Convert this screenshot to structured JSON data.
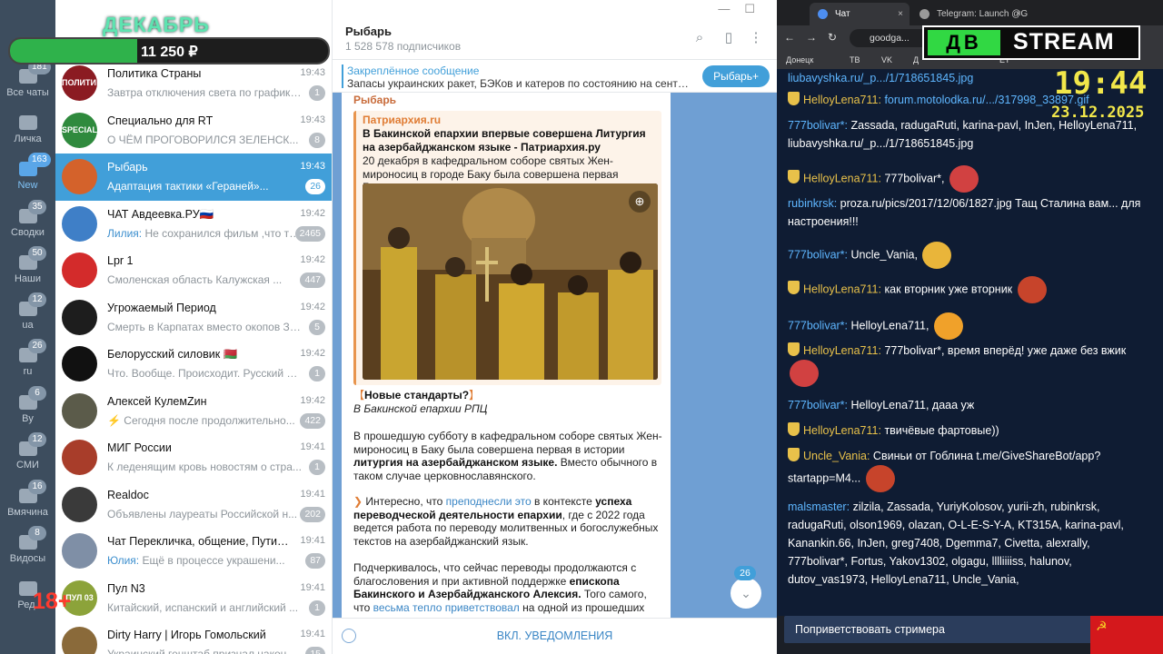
{
  "overlay": {
    "month": "ДЕКАБРЬ",
    "amount": "11 250 ₽",
    "progress_fraction": 0.4,
    "age_rating": "18+",
    "logo_db": "ДВ",
    "logo_stream": "STREAM",
    "clock_time": "19:44",
    "clock_date": "23.12.2025"
  },
  "folders": [
    {
      "label": "Все чаты",
      "badge": "181"
    },
    {
      "label": "Личка",
      "badge": ""
    },
    {
      "label": "New",
      "badge": "163"
    },
    {
      "label": "Сводки",
      "badge": "35"
    },
    {
      "label": "Наши",
      "badge": "50"
    },
    {
      "label": "ua",
      "badge": "12"
    },
    {
      "label": "ru",
      "badge": "26"
    },
    {
      "label": "By",
      "badge": "6"
    },
    {
      "label": "СМИ",
      "badge": "12"
    },
    {
      "label": "Вмячина",
      "badge": "16"
    },
    {
      "label": "Видосы",
      "badge": "8"
    },
    {
      "label": "Ред.",
      "badge": ""
    }
  ],
  "chats": [
    {
      "name": "Политика Страны",
      "time": "19:43",
      "preview": "Завтра отключения света по графика...",
      "sender": "",
      "badge": "1",
      "avatar_color": "#8b1b22",
      "avatar_text": "ПОЛИТИКА"
    },
    {
      "name": "Специально для RT",
      "time": "19:43",
      "preview": "О ЧЁМ ПРОГОВОРИЛСЯ ЗЕЛЕНСК...",
      "sender": "",
      "badge": "8",
      "avatar_color": "#2f8a3d",
      "avatar_text": "SPECIAL"
    },
    {
      "name": "Рыбарь",
      "time": "19:43",
      "preview": "Адаптация тактики «Гераней»...",
      "sender": "",
      "badge": "26",
      "avatar_color": "#d4622b",
      "avatar_text": ""
    },
    {
      "name": "ЧАТ Авдеевка.РУ🇷🇺",
      "time": "19:42",
      "preview": "Не сохранился фильм ,что ты ...",
      "sender": "Лилия: ",
      "badge": "2465",
      "avatar_color": "#3f7fc7",
      "avatar_text": ""
    },
    {
      "name": "Lpr 1",
      "time": "19:42",
      "preview": "Смоленская область  Калужская ...",
      "sender": "",
      "badge": "447",
      "avatar_color": "#d32b2b",
      "avatar_text": ""
    },
    {
      "name": "Угрожаемый Период",
      "time": "19:42",
      "preview": "Смерть в Карпатах вместо окопов Зе...",
      "sender": "",
      "badge": "5",
      "avatar_color": "#1d1d1d",
      "avatar_text": ""
    },
    {
      "name": "Белорусский силовик 🇧🇾",
      "time": "19:42",
      "preview": "Что. Вообще. Происходит.  Русский м...",
      "sender": "",
      "badge": "1",
      "avatar_color": "#111111",
      "avatar_text": ""
    },
    {
      "name": "Алексей КулемZин",
      "time": "19:42",
      "preview": "⚡ Сегодня после продолжительно...",
      "sender": "",
      "badge": "422",
      "avatar_color": "#5b5b4a",
      "avatar_text": ""
    },
    {
      "name": "МИГ России",
      "time": "19:41",
      "preview": "К леденящим кровь новостям о стра...",
      "sender": "",
      "badge": "1",
      "avatar_color": "#a83d2a",
      "avatar_text": ""
    },
    {
      "name": "Realdoc",
      "time": "19:41",
      "preview": "Объявлены лауреаты Российской н...",
      "sender": "",
      "badge": "202",
      "avatar_color": "#3a3a3a",
      "avatar_text": ""
    },
    {
      "name": "Чат Перекличка, общение, Путил...",
      "time": "19:41",
      "preview": "Ещё в процессе украшени...",
      "sender": "Юлия: ",
      "badge": "87",
      "avatar_color": "#7f8fa6",
      "avatar_text": ""
    },
    {
      "name": "Пул N3",
      "time": "19:41",
      "preview": "Китайский, испанский и английский ...",
      "sender": "",
      "badge": "1",
      "avatar_color": "#8ca33a",
      "avatar_text": "ПУЛ 03"
    },
    {
      "name": "Dirty Harry | Игорь Гомольский",
      "time": "19:41",
      "preview": "Украинский генштаб признал наконец у...",
      "sender": "",
      "badge": "15",
      "avatar_color": "#8a6a3a",
      "avatar_text": ""
    }
  ],
  "channel": {
    "title": "Рыбарь",
    "subscribers": "1 528 578 подписчиков",
    "pinned_title": "Закреплённое сообщение",
    "pinned_text": "Запасы украинских ракет, БЭКов и катеров по состоянию на сентяб...",
    "pinned_button": "Рыбарь+",
    "notify_button": "ВКЛ. УВЕДОМЛЕНИЯ",
    "scroll_badge": "26"
  },
  "message": {
    "author": "Рыбарь",
    "quote_source": "Патриархия.ru",
    "quote_title": "В Бакинской епархии впервые совершена Литургия на азербайджанском языке - Патриархия.ру",
    "quote_desc": "20 декабря в кафедральном соборе святых Жен-мироносиц в городе Баку была совершена первая Божественная литурги...",
    "heading": "Новые стандарты?",
    "heading_sub": "В Бакинской епархии РПЦ",
    "p1_a": "В прошедшую субботу в кафедральном соборе святых Жен-мироносиц в Баку была совершена первая в истории ",
    "p1_b": "литургия на азербайджанском языке.",
    "p1_c": " Вместо обычного в таком случае церковнославянского.",
    "p2_a": "Интересно, что ",
    "p2_link": "преподнесли это",
    "p2_b": " в контексте ",
    "p2_bold": "успеха переводческой деятельности епархии",
    "p2_c": ", где с 2022 года ведется работа по переводу молитвенных и богослужебных текстов на азербайджанский язык.",
    "p3_a": "Подчеркивалось, что сейчас переводы продолжаются с благословения и при активной поддержке ",
    "p3_bold": "епископа Бакинского и Азербайджанского Алексия.",
    "p3_b": " Того самого, что ",
    "p3_link": "весьма тепло приветствовал",
    "p3_c": " на одной из прошедших"
  },
  "browser": {
    "tab1": "Чат",
    "tab2": "Telegram: Launch @G",
    "url": "goodga...",
    "bookmarks": [
      "Донецк",
      "ТВ",
      "VK",
      "Д",
      "ЕТ"
    ]
  },
  "stream_chat": [
    {
      "user": "",
      "text": "liubavyshka.ru/_p.../1/718651845.jpg",
      "gold": false,
      "link": true
    },
    {
      "user": "HelloyLena711:",
      "text": "forum.motolodka.ru/.../317998_33897.gif",
      "gold": true,
      "link": true
    },
    {
      "user": "777bolivar*:",
      "text": "Zassada, radugaRuti, karina-pavl, InJen, HelloyLena711, liubavyshka.ru/_p.../1/718651845.jpg",
      "gold": false,
      "link": false
    },
    {
      "user": "HelloyLena711:",
      "text": "777bolivar*,",
      "gold": true,
      "link": false
    },
    {
      "user": "rubinkrsk:",
      "text": "proza.ru/pics/2017/12/06/1827.jpg Тащ Сталина вам... для настроения!!!",
      "gold": false,
      "link": false
    },
    {
      "user": "777bolivar*:",
      "text": "Uncle_Vania,",
      "gold": false,
      "link": false
    },
    {
      "user": "HelloyLena711:",
      "text": "как вторник  уже вторник",
      "gold": true,
      "link": false
    },
    {
      "user": "777bolivar*:",
      "text": "HelloyLena711,",
      "gold": false,
      "link": false
    },
    {
      "user": "HelloyLena711:",
      "text": "777bolivar*, время вперёд! уже даже без вжик",
      "gold": true,
      "link": false
    },
    {
      "user": "777bolivar*:",
      "text": "HelloyLena711, дааа уж",
      "gold": false,
      "link": false
    },
    {
      "user": "HelloyLena711:",
      "text": "твичёвые фартовые))",
      "gold": true,
      "link": false
    },
    {
      "user": "Uncle_Vania:",
      "text": "Свиньи от Гоблина t.me/GiveShareBot/app?startapp=M4...",
      "gold": true,
      "link": false
    },
    {
      "user": "malsmaster:",
      "text": "zilzila, Zassada, YuriyKolosov, yurii-zh, rubinkrsk, radugaRuti, olson1969, olazan, O-L-E-S-Y-A, KT315A, karina-pavl, Kanankin.66, InJen, greg7408, Dgemma7, Civetta, alexrally, 777bolivar*, Fortus, Yakov1302, olgagu, lllliiiiss, halunov, dutov_vas1973, HelloyLena711, Uncle_Vania,",
      "gold": false,
      "link": false
    }
  ],
  "chat_input_placeholder": "Поприветствовать стримера",
  "colors": {
    "telegram_blue": "#419fd9",
    "overlay_green": "#2fb24b",
    "clock_yellow": "#f2e74a"
  }
}
